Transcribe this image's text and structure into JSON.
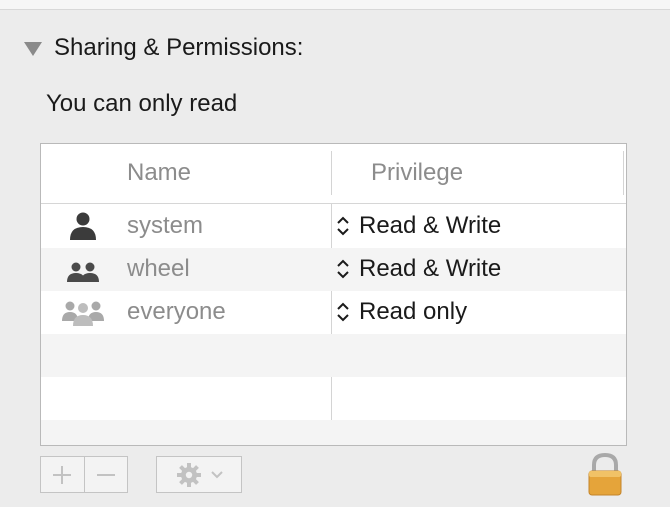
{
  "section": {
    "title": "Sharing & Permissions:",
    "status": "You can only read"
  },
  "table": {
    "columns": [
      "Name",
      "Privilege"
    ],
    "rows": [
      {
        "name": "system",
        "privilege": "Read & Write",
        "icon": "single-user-icon"
      },
      {
        "name": "wheel",
        "privilege": "Read & Write",
        "icon": "group-icon"
      },
      {
        "name": "everyone",
        "privilege": "Read only",
        "icon": "everyone-icon"
      }
    ]
  },
  "footer": {
    "add_icon": "plus-icon",
    "remove_icon": "minus-icon",
    "action_icon": "gear-icon",
    "lock_icon": "lock-icon"
  },
  "colors": {
    "background": "#ececec",
    "muted_text": "#8c8c8c",
    "lock_gold": "#e5a43a"
  }
}
